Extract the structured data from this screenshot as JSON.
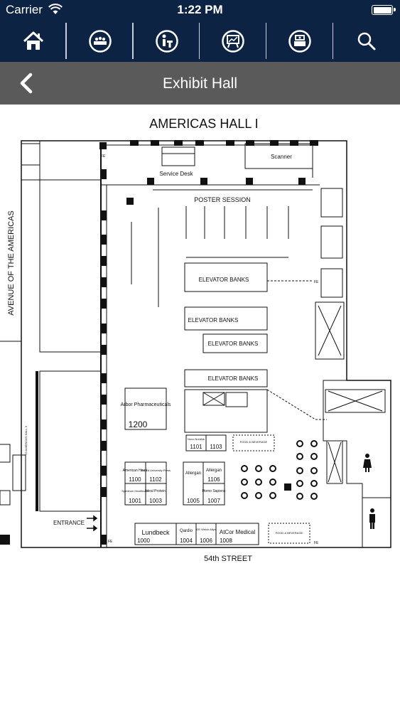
{
  "status_bar": {
    "carrier": "Carrier",
    "time": "1:22 PM"
  },
  "nav": {
    "items": [
      {
        "icon": "home-icon"
      },
      {
        "icon": "sessions-icon"
      },
      {
        "icon": "speaker-icon"
      },
      {
        "icon": "poster-icon"
      },
      {
        "icon": "exhibitor-icon"
      },
      {
        "icon": "search-icon"
      }
    ]
  },
  "header": {
    "title": "Exhibit Hall"
  },
  "map": {
    "hall_title": "AMERICAS HALL I",
    "street_left": "AVENUE OF THE AMERICAS",
    "street_bottom": "54th STREET",
    "scanner": "Scanner",
    "service_desk": "Service Desk",
    "poster_session": "POSTER SESSION",
    "elevator_banks": "ELEVATOR BANKS",
    "entrance": "ENTRANCE",
    "food_beverage": "FOOD & BEVERAGE",
    "to_americas_hall": "TO AMERICAS HALL II",
    "fe": "FE",
    "booths": {
      "b1200": {
        "name": "Arbor Pharmaceuticals",
        "number": "1200"
      },
      "b1101": {
        "name": "Novo Nordisk",
        "number": "1101"
      },
      "b1103": {
        "number": "1103"
      },
      "b1100": {
        "name": "American Heart",
        "number": "1100"
      },
      "b1102": {
        "name": "Oxford University Press",
        "number": "1102"
      },
      "b1001": {
        "name": "Spectrum Healthcare",
        "number": "1001"
      },
      "b1003": {
        "name": "Ideal Protein",
        "number": "1003"
      },
      "b1005": {
        "name": "Allergan",
        "number": "1005"
      },
      "b1106": {
        "name": "Allergan",
        "number": "1106"
      },
      "b1007": {
        "name": "Homo Sapiens",
        "number": "1007"
      },
      "b1000": {
        "name": "Lundbeck",
        "number": "1000"
      },
      "b1004": {
        "name": "Qardio",
        "number": "1004"
      },
      "b1006": {
        "name": "GE Welch Allyn",
        "number": "1006"
      },
      "b1008": {
        "name": "AtCor Medical",
        "number": "1008"
      }
    }
  },
  "colors": {
    "header": "#0d2344",
    "title_bar": "#5a5a5a"
  }
}
